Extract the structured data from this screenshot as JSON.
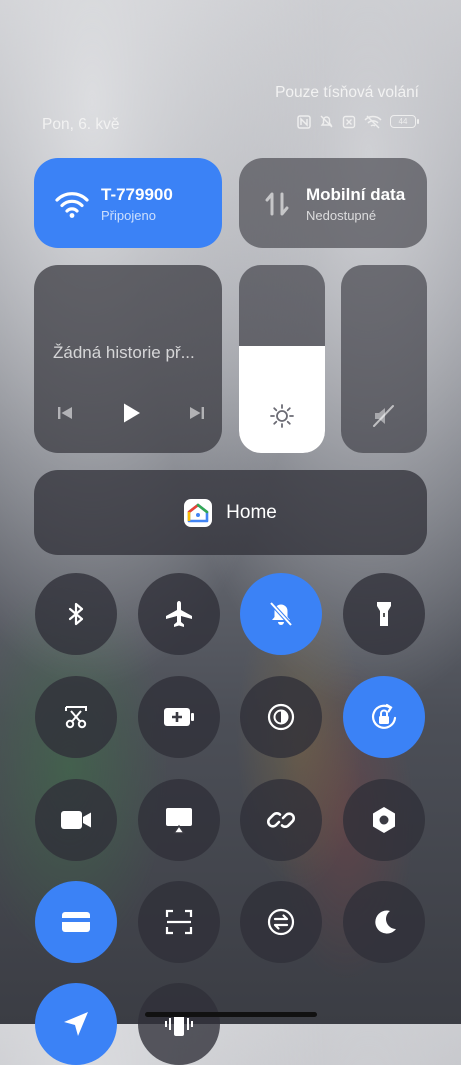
{
  "status": {
    "emergency_text": "Pouze tísňová volání",
    "date": "Pon, 6. kvě",
    "battery": "44",
    "icons": [
      "nfc-icon",
      "silent-icon",
      "no-sim-icon",
      "wifi-off-icon",
      "battery-icon"
    ]
  },
  "wifi": {
    "title": "T-779900",
    "subtitle": "Připojeno",
    "active": true
  },
  "mobile_data": {
    "title": "Mobilní data",
    "subtitle": "Nedostupné",
    "active": false
  },
  "media": {
    "text": "Žádná historie př..."
  },
  "brightness": {
    "level": 0.57
  },
  "volume": {
    "level": 0.0,
    "muted": true
  },
  "home": {
    "label": "Home"
  },
  "toggles": [
    {
      "name": "bluetooth",
      "icon": "bluetooth-icon",
      "active": false
    },
    {
      "name": "airplane-mode",
      "icon": "airplane-icon",
      "active": false
    },
    {
      "name": "silent-mode",
      "icon": "bell-off-icon",
      "active": true
    },
    {
      "name": "flashlight",
      "icon": "flashlight-icon",
      "active": false
    },
    {
      "name": "screenshot",
      "icon": "scissors-icon",
      "active": false
    },
    {
      "name": "battery-saver",
      "icon": "battery-plus-icon",
      "active": false
    },
    {
      "name": "reading-mode",
      "icon": "contrast-icon",
      "active": false
    },
    {
      "name": "rotation-lock",
      "icon": "rotation-lock-icon",
      "active": true
    },
    {
      "name": "video-record",
      "icon": "video-icon",
      "active": false
    },
    {
      "name": "cast",
      "icon": "cast-icon",
      "active": false
    },
    {
      "name": "link",
      "icon": "link-icon",
      "active": false
    },
    {
      "name": "settings-hex",
      "icon": "hex-nut-icon",
      "active": false
    },
    {
      "name": "wallet",
      "icon": "card-icon",
      "active": true
    },
    {
      "name": "scan",
      "icon": "scan-icon",
      "active": false
    },
    {
      "name": "sync",
      "icon": "sync-icon",
      "active": false
    },
    {
      "name": "dark-mode",
      "icon": "moon-icon",
      "active": false
    },
    {
      "name": "location",
      "icon": "location-arrow-icon",
      "active": true
    },
    {
      "name": "vibrate",
      "icon": "vibrate-icon",
      "active": false
    }
  ],
  "colors": {
    "accent": "#3b82f6",
    "tile": "#3a3a42"
  }
}
